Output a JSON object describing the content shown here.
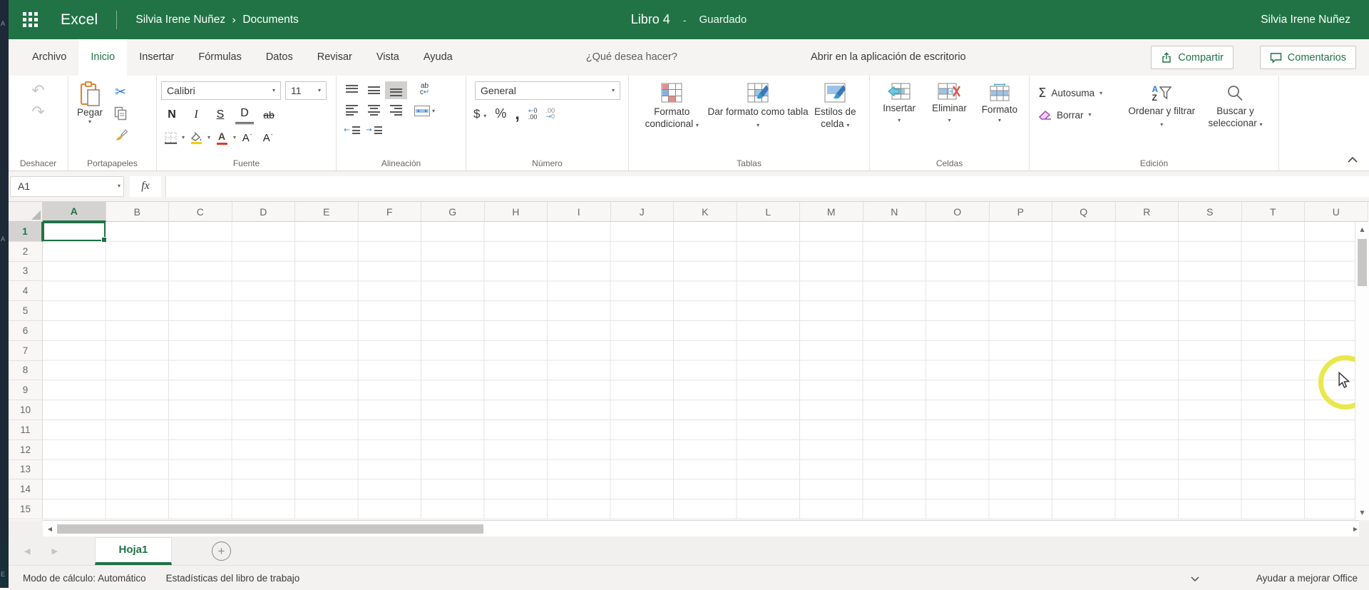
{
  "side_strip": {
    "letters": [
      "A",
      "A",
      "E"
    ]
  },
  "header": {
    "app_name": "Excel",
    "breadcrumb_user": "Silvia Irene Nuñez",
    "breadcrumb_separator": "›",
    "breadcrumb_location": "Documents",
    "doc_title": "Libro 4",
    "title_separator": "-",
    "save_status": "Guardado",
    "account_name": "Silvia Irene Nuñez"
  },
  "menu": {
    "tabs": [
      {
        "label": "Archivo",
        "active": false
      },
      {
        "label": "Inicio",
        "active": true
      },
      {
        "label": "Insertar",
        "active": false
      },
      {
        "label": "Fórmulas",
        "active": false
      },
      {
        "label": "Datos",
        "active": false
      },
      {
        "label": "Revisar",
        "active": false
      },
      {
        "label": "Vista",
        "active": false
      },
      {
        "label": "Ayuda",
        "active": false
      }
    ],
    "tell_me": "¿Qué desea hacer?",
    "open_in_desktop": "Abrir en la aplicación de escritorio",
    "share_label": "Compartir",
    "comments_label": "Comentarios"
  },
  "ribbon": {
    "undo_group": {
      "label": "Deshacer"
    },
    "clipboard_group": {
      "label": "Portapapeles",
      "paste_label": "Pegar"
    },
    "font_group": {
      "label": "Fuente",
      "font_name": "Calibri",
      "font_size": "11",
      "bold": "N",
      "italic": "I",
      "underline": "S",
      "double_underline": "D",
      "strikethrough": "ab"
    },
    "alignment_group": {
      "label": "Alineación",
      "wrap_top": "ab",
      "wrap_bottom": "c"
    },
    "number_group": {
      "label": "Número",
      "format": "General",
      "currency": "$",
      "percent": "%",
      "comma": ","
    },
    "tables_group": {
      "label": "Tablas",
      "conditional": "Formato condicional",
      "format_table": "Dar formato como tabla",
      "cell_styles": "Estilos de celda"
    },
    "cells_group": {
      "label": "Celdas",
      "insert": "Insertar",
      "delete": "Eliminar",
      "format": "Formato"
    },
    "editing_group": {
      "label": "Edición",
      "autosum_sigma": "Σ",
      "autosum": "Autosuma",
      "clear": "Borrar",
      "sort": "Ordenar y filtrar",
      "find": "Buscar y seleccionar"
    }
  },
  "formula_bar": {
    "name_box": "A1",
    "fx": "fx"
  },
  "grid": {
    "columns": [
      "A",
      "B",
      "C",
      "D",
      "E",
      "F",
      "G",
      "H",
      "I",
      "J",
      "K",
      "L",
      "M",
      "N",
      "O",
      "P",
      "Q",
      "R",
      "S",
      "T",
      "U"
    ],
    "rows": [
      "1",
      "2",
      "3",
      "4",
      "5",
      "6",
      "7",
      "8",
      "9",
      "10",
      "11",
      "12",
      "13",
      "14",
      "15"
    ],
    "selected_column": "A",
    "selected_row": "1"
  },
  "sheet_bar": {
    "active_sheet": "Hoja1"
  },
  "status_bar": {
    "calc_mode": "Modo de cálculo: Automático",
    "stats": "Estadísticas del libro de trabajo",
    "help": "Ayudar a mejorar Office"
  },
  "colors": {
    "excel_green": "#217346",
    "selection_green": "#1e7145",
    "click_highlight": "#e7e63b",
    "icon_blue": "#2b7cd3"
  }
}
